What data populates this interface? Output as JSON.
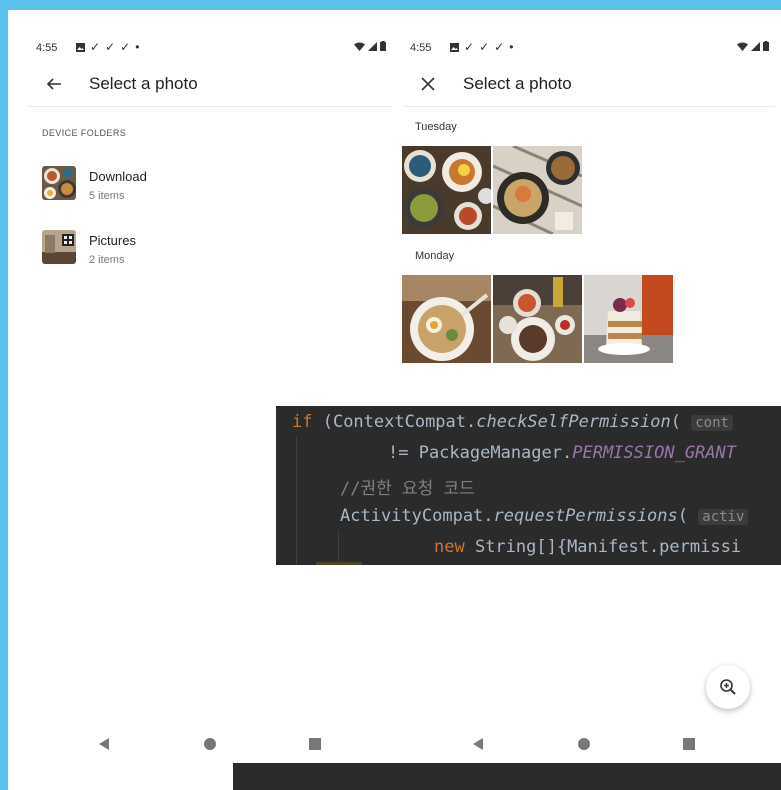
{
  "left_screen": {
    "status": {
      "time": "4:55",
      "notification_icons": [
        "image-icon",
        "check-icon",
        "check-icon",
        "check-icon",
        "dot-icon"
      ]
    },
    "toolbar": {
      "title": "Select a photo",
      "nav_icon": "back-arrow-icon"
    },
    "section_label": "DEVICE FOLDERS",
    "folders": [
      {
        "name": "Download",
        "count": "5 items"
      },
      {
        "name": "Pictures",
        "count": "2 items"
      }
    ]
  },
  "right_screen": {
    "status": {
      "time": "4:55",
      "notification_icons": [
        "image-icon",
        "check-icon",
        "check-icon",
        "check-icon",
        "dot-icon"
      ]
    },
    "toolbar": {
      "title": "Select a photo",
      "nav_icon": "close-icon"
    },
    "groups": [
      {
        "label": "Tuesday",
        "photos": [
          "food-photo",
          "food-photo"
        ]
      },
      {
        "label": "Monday",
        "photos": [
          "ramen-photo",
          "dinner-photo",
          "cake-photo"
        ]
      }
    ],
    "fab_icon": "zoom-in-icon"
  },
  "code_overlay": {
    "line1": {
      "kw": "if",
      "text": " (ContextCompat.",
      "method": "checkSelfPermission",
      "paren": "(",
      "hint": "cont"
    },
    "line2": {
      "text": "!= PackageManager.",
      "const": "PERMISSION_GRANT"
    },
    "line3": {
      "comment": "//권한 요청 코드"
    },
    "line4": {
      "text": "ActivityCompat.",
      "method": "requestPermissions",
      "paren": "(",
      "hint": "activ"
    },
    "line5": {
      "kw": "new",
      "text": " String[]{Manifest.permissi"
    }
  },
  "colors": {
    "background": "#5bc2f0",
    "code_bg": "#2b2b2b",
    "keyword": "#cc7832",
    "constant": "#9876aa"
  }
}
